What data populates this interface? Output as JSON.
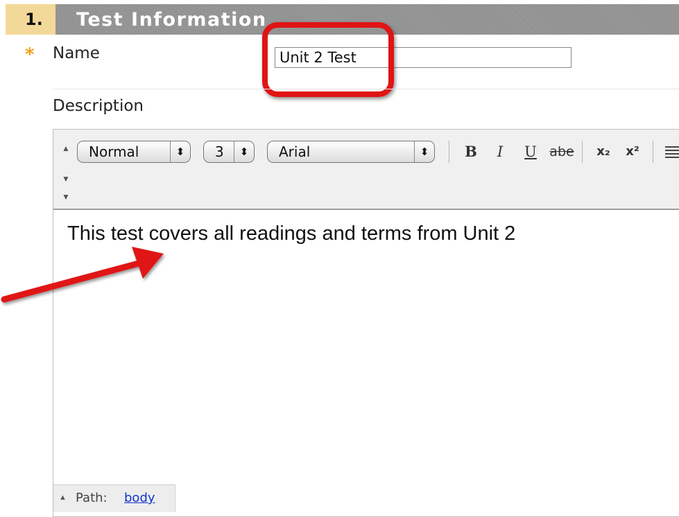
{
  "section": {
    "number": "1.",
    "title": "Test Information"
  },
  "name_field": {
    "required_marker": "*",
    "label": "Name",
    "value": "Unit 2 Test"
  },
  "description": {
    "label": "Description"
  },
  "toolbar": {
    "format_select": "Normal",
    "size_select": "3",
    "font_select": "Arial",
    "bold": "B",
    "italic": "I",
    "underline": "U",
    "strikethrough": "abe",
    "subscript": "x₂",
    "superscript": "x²",
    "select_arrows": "⬍"
  },
  "editor": {
    "content": "This test covers all readings and terms from Unit 2"
  },
  "path_bar": {
    "label": "Path:",
    "link": "body"
  },
  "colors": {
    "accent_star": "#f2a11f",
    "header_num_bg": "#f3d999",
    "annotation_red": "#e01414",
    "link": "#1133cc"
  }
}
